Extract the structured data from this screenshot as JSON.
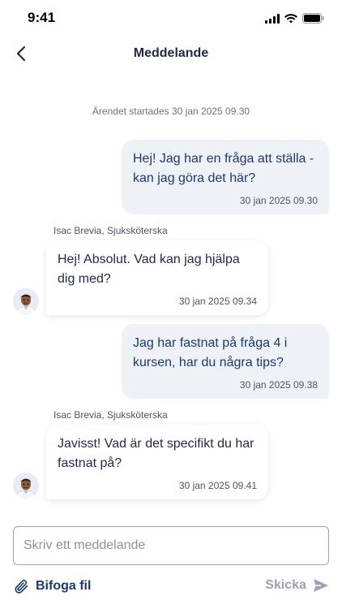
{
  "status_bar": {
    "time": "9:41"
  },
  "header": {
    "title": "Meddelande"
  },
  "chat": {
    "started_label": "Ärendet startades 30 jan 2025 09.30",
    "messages": [
      {
        "text": "Hej! Jag har en fråga att ställa - kan jag göra det här?",
        "time": "30 jan 2025 09.30"
      },
      {
        "sender": "Isac Brevia, Sjuksköterska",
        "text": "Hej! Absolut. Vad kan jag hjälpa dig med?",
        "time": "30 jan 2025 09.34"
      },
      {
        "text": "Jag har fastnat på fråga 4 i kursen, har du några tips?",
        "time": "30 jan 2025 09.38"
      },
      {
        "sender": "Isac Brevia, Sjuksköterska",
        "text": "Javisst! Vad är det specifikt du har fastnat på?",
        "time": "30 jan 2025 09.41"
      }
    ]
  },
  "composer": {
    "placeholder": "Skriv ett meddelande",
    "value": ""
  },
  "actions": {
    "attach_label": "Bifoga fil",
    "send_label": "Skicka"
  },
  "colors": {
    "primary": "#1d3a72",
    "outgoing_bubble": "#eef1f6",
    "disabled": "#9aa3b2"
  },
  "icons": {
    "back": "chevron-left-icon",
    "attach": "paperclip-icon",
    "send": "send-icon"
  }
}
